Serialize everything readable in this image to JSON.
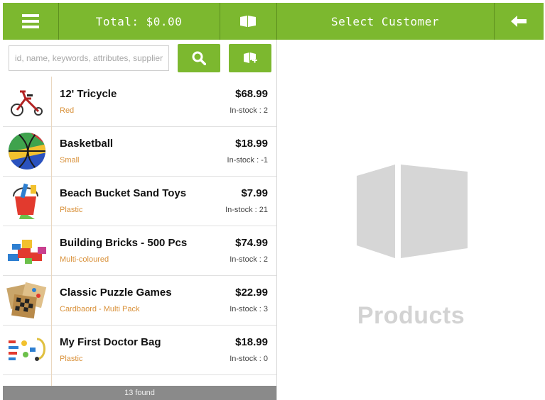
{
  "header": {
    "menu_icon": "hamburger-menu-icon",
    "total_label": "Total: $0.00",
    "box_icon": "product-box-icon",
    "select_customer_label": "Select Customer",
    "back_icon": "back-arrow-icon"
  },
  "search": {
    "placeholder": "id, name, keywords, attributes, supplier upc",
    "search_icon": "search-icon",
    "add_product_icon": "add-product-box-icon"
  },
  "products": [
    {
      "name": "12' Tricycle",
      "attribute": "Red",
      "price": "$68.99",
      "stock": "In-stock : 2",
      "icon": "tricycle-icon"
    },
    {
      "name": "Basketball",
      "attribute": "Small",
      "price": "$18.99",
      "stock": "In-stock : -1",
      "icon": "basketball-icon"
    },
    {
      "name": "Beach Bucket Sand Toys",
      "attribute": "Plastic",
      "price": "$7.99",
      "stock": "In-stock : 21",
      "icon": "sand-bucket-icon"
    },
    {
      "name": "Building Bricks - 500 Pcs",
      "attribute": "Multi-coloured",
      "price": "$74.99",
      "stock": "In-stock : 2",
      "icon": "building-bricks-icon"
    },
    {
      "name": "Classic Puzzle Games",
      "attribute": "Cardbaord - Multi Pack",
      "price": "$22.99",
      "stock": "In-stock : 3",
      "icon": "board-games-icon"
    },
    {
      "name": "My First Doctor Bag",
      "attribute": "Plastic",
      "price": "$18.99",
      "stock": "In-stock : 0",
      "icon": "doctor-bag-icon"
    }
  ],
  "found_label": "13 found",
  "empty_state": {
    "icon": "large-box-icon",
    "label": "Products"
  },
  "colors": {
    "accent": "#7cb82f",
    "attribute_text": "#d9913a",
    "footer_bar": "#8a8a8a",
    "placeholder_graphic": "#d3d3d3"
  }
}
